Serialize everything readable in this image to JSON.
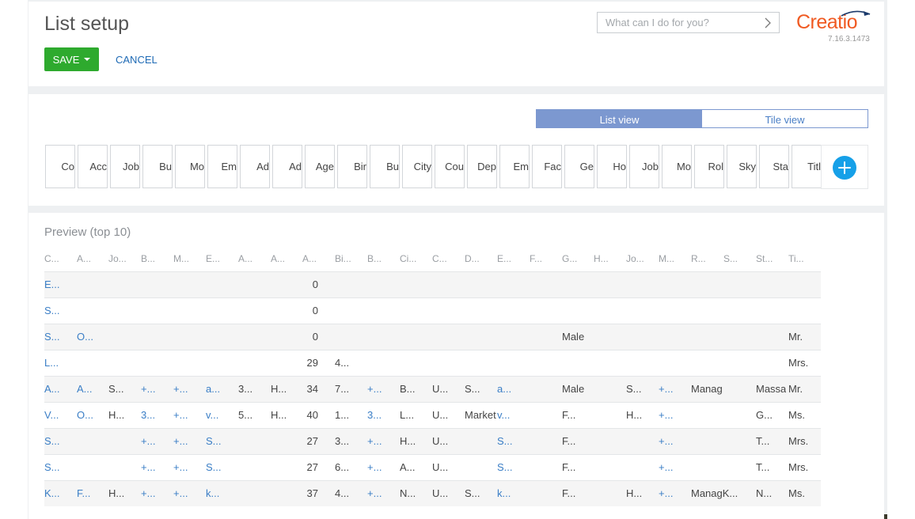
{
  "header": {
    "title": "List setup",
    "save_label": "SAVE",
    "cancel_label": "CANCEL",
    "search_placeholder": "What can I do for you?",
    "logo_text": "Creatio",
    "version": "7.16.3.1473"
  },
  "view_toggle": {
    "list_view": "List view",
    "tile_view": "Tile view",
    "active": "List view"
  },
  "columns": [
    "Co",
    "Acc",
    "Job",
    "Bu",
    "Mo",
    "Em",
    "Ad",
    "Ad",
    "Age",
    "Bir",
    "Bu",
    "City",
    "Cou",
    "Dep",
    "Em",
    "Fac",
    "Ge",
    "Ho",
    "Job",
    "Mo",
    "Rol",
    "Sky",
    "Sta",
    "Titl"
  ],
  "preview": {
    "title": "Preview (top 10)",
    "headers": [
      "C...",
      "A...",
      "Jo...",
      "B...",
      "M...",
      "E...",
      "A...",
      "A...",
      "A...",
      "Bi...",
      "B...",
      "Ci...",
      "C...",
      "D...",
      "E...",
      "F...",
      "G...",
      "H...",
      "Jo...",
      "M...",
      "R...",
      "S...",
      "St...",
      "Ti..."
    ],
    "rows": [
      [
        "E...",
        "",
        "",
        "",
        "",
        "",
        "",
        "",
        "0",
        "",
        "",
        "",
        "",
        "",
        "",
        "",
        "",
        "",
        "",
        "",
        "",
        "",
        "",
        ""
      ],
      [
        "S...",
        "",
        "",
        "",
        "",
        "",
        "",
        "",
        "0",
        "",
        "",
        "",
        "",
        "",
        "",
        "",
        "",
        "",
        "",
        "",
        "",
        "",
        "",
        ""
      ],
      [
        "S...",
        "O...",
        "",
        "",
        "",
        "",
        "",
        "",
        "0",
        "",
        "",
        "",
        "",
        "",
        "",
        "",
        "Male",
        "",
        "",
        "",
        "",
        "",
        "",
        "Mr."
      ],
      [
        "L...",
        "",
        "",
        "",
        "",
        "",
        "",
        "",
        "29",
        "4...",
        "",
        "",
        "",
        "",
        "",
        "",
        "",
        "",
        "",
        "",
        "",
        "",
        "",
        "Mrs."
      ],
      [
        "A...",
        "A...",
        "S...",
        "+...",
        "+...",
        "a...",
        "3...",
        "H...",
        "34",
        "7...",
        "+...",
        "B...",
        "U...",
        "S...",
        "a...",
        "",
        "Male",
        "",
        "S...",
        "+...",
        "Manag",
        "",
        "Massa",
        "Mr."
      ],
      [
        "V...",
        "O...",
        "H...",
        "3...",
        "+...",
        "v...",
        "5...",
        "H...",
        "40",
        "1...",
        "3...",
        "L...",
        "U...",
        "Market",
        "v...",
        "",
        "F...",
        "",
        "H...",
        "+...",
        "",
        "",
        "G...",
        "Ms."
      ],
      [
        "S...",
        "",
        "",
        "+...",
        "+...",
        "S...",
        "",
        "",
        "27",
        "3...",
        "+...",
        "H...",
        "U...",
        "",
        "S...",
        "",
        "F...",
        "",
        "",
        "+...",
        "",
        "",
        "T...",
        "Mrs."
      ],
      [
        "S...",
        "",
        "",
        "+...",
        "+...",
        "S...",
        "",
        "",
        "27",
        "6...",
        "+...",
        "A...",
        "U...",
        "",
        "S...",
        "",
        "F...",
        "",
        "",
        "+...",
        "",
        "",
        "T...",
        "Mrs."
      ],
      [
        "K...",
        "F...",
        "H...",
        "+...",
        "+...",
        "k...",
        "",
        "",
        "37",
        "4...",
        "+...",
        "N...",
        "U...",
        "S...",
        "k...",
        "",
        "F...",
        "",
        "H...",
        "+...",
        "ManagK...",
        "",
        "N...",
        "Ms."
      ]
    ],
    "link_columns": [
      0,
      1,
      3,
      4,
      5,
      10,
      14,
      19
    ]
  },
  "colors": {
    "save": "#2eaa2e",
    "cancel": "#1e6ab5",
    "toggle_active": "#7c98d0",
    "add": "#16a0e8",
    "logo": "#f05a22",
    "link": "#3a7ec6"
  }
}
